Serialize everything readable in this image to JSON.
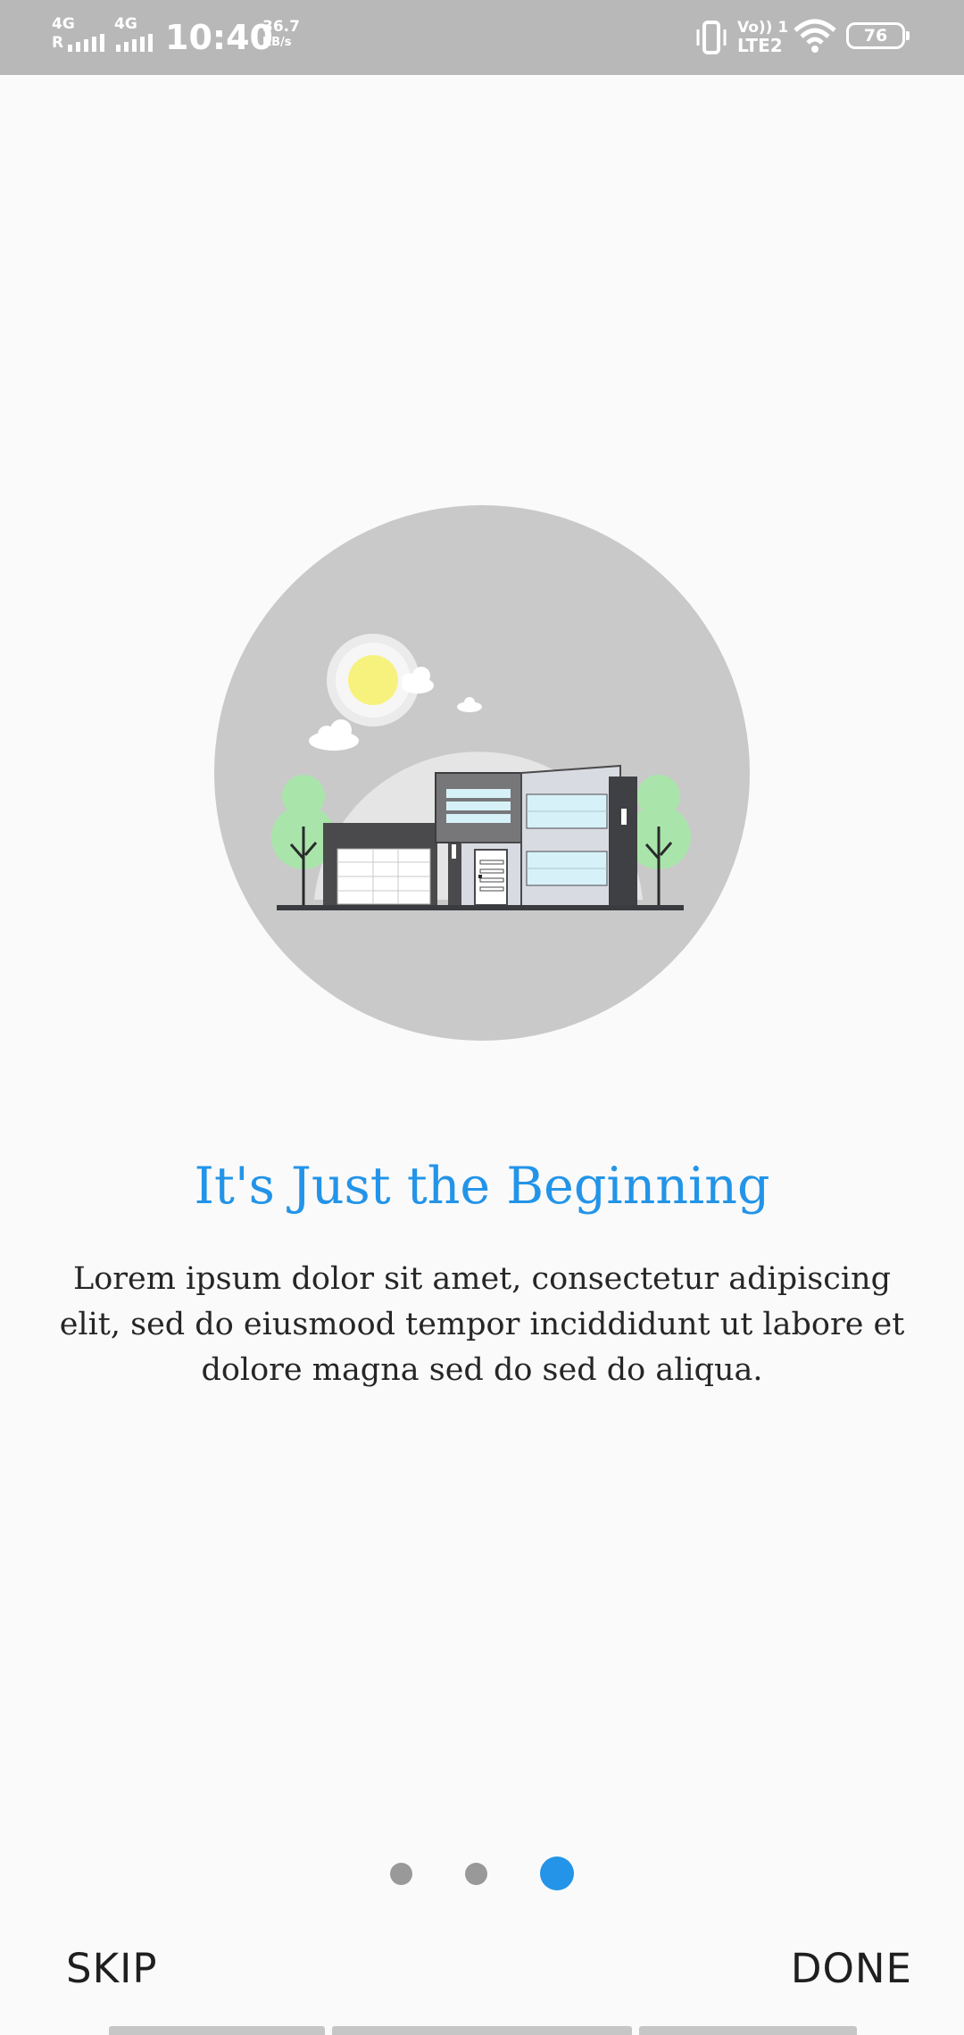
{
  "status_bar": {
    "sim1_network": "4G",
    "sim1_roaming": "R",
    "sim2_network": "4G",
    "time": "10:40",
    "speed_value": "36.7",
    "speed_unit": "KB/s",
    "volte_line1": "Vo)) 1",
    "volte_line2": "LTE2",
    "battery": "76"
  },
  "onboarding": {
    "title": "It's Just the Beginning",
    "description": "Lorem ipsum dolor sit amet, consectetur adipiscing elit, sed do eiusmood tempor inciddidunt ut labore et dolore magna sed do sed do aliqua.",
    "page_count": 3,
    "current_page": 3
  },
  "actions": {
    "skip_label": "SKIP",
    "done_label": "DONE"
  },
  "colors": {
    "accent": "#2394e8",
    "background": "#fafafa",
    "status_bar": "#b8b8b8",
    "dot_inactive": "#999999"
  }
}
